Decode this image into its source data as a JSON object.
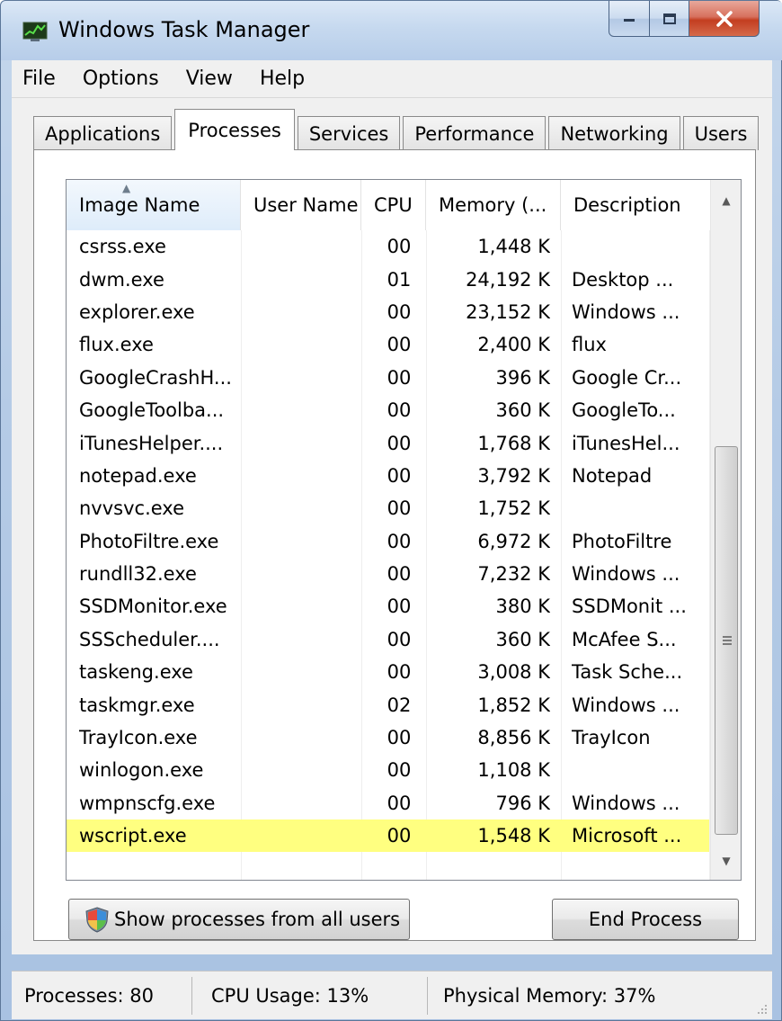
{
  "window": {
    "title": "Windows Task Manager",
    "icon": "task-manager-icon"
  },
  "menu": [
    "File",
    "Options",
    "View",
    "Help"
  ],
  "tabs": [
    {
      "label": "Applications",
      "active": false
    },
    {
      "label": "Processes",
      "active": true
    },
    {
      "label": "Services",
      "active": false
    },
    {
      "label": "Performance",
      "active": false
    },
    {
      "label": "Networking",
      "active": false
    },
    {
      "label": "Users",
      "active": false
    }
  ],
  "columns": {
    "image_name": "Image Name",
    "user_name": "User Name",
    "cpu": "CPU",
    "memory": "Memory (...",
    "description": "Description"
  },
  "processes": [
    {
      "name": "csrss.exe",
      "user": "",
      "cpu": "00",
      "memory": "1,448 K",
      "description": ""
    },
    {
      "name": "dwm.exe",
      "user": "",
      "cpu": "01",
      "memory": "24,192 K",
      "description": "Desktop ..."
    },
    {
      "name": "explorer.exe",
      "user": "",
      "cpu": "00",
      "memory": "23,152 K",
      "description": "Windows ..."
    },
    {
      "name": "flux.exe",
      "user": "",
      "cpu": "00",
      "memory": "2,400 K",
      "description": "flux"
    },
    {
      "name": "GoogleCrashH...",
      "user": "",
      "cpu": "00",
      "memory": "396 K",
      "description": "Google Cr..."
    },
    {
      "name": "GoogleToolba...",
      "user": "",
      "cpu": "00",
      "memory": "360 K",
      "description": "GoogleTo..."
    },
    {
      "name": "iTunesHelper....",
      "user": "",
      "cpu": "00",
      "memory": "1,768 K",
      "description": "iTunesHel..."
    },
    {
      "name": "notepad.exe",
      "user": "",
      "cpu": "00",
      "memory": "3,792 K",
      "description": "Notepad"
    },
    {
      "name": "nvvsvc.exe",
      "user": "",
      "cpu": "00",
      "memory": "1,752 K",
      "description": ""
    },
    {
      "name": "PhotoFiltre.exe",
      "user": "",
      "cpu": "00",
      "memory": "6,972 K",
      "description": "PhotoFiltre"
    },
    {
      "name": "rundll32.exe",
      "user": "",
      "cpu": "00",
      "memory": "7,232 K",
      "description": "Windows ..."
    },
    {
      "name": "SSDMonitor.exe",
      "user": "",
      "cpu": "00",
      "memory": "380 K",
      "description": "SSDMonit ..."
    },
    {
      "name": "SSScheduler....",
      "user": "",
      "cpu": "00",
      "memory": "360 K",
      "description": "McAfee S..."
    },
    {
      "name": "taskeng.exe",
      "user": "",
      "cpu": "00",
      "memory": "3,008 K",
      "description": "Task Sche..."
    },
    {
      "name": "taskmgr.exe",
      "user": "",
      "cpu": "02",
      "memory": "1,852 K",
      "description": "Windows ..."
    },
    {
      "name": "TrayIcon.exe",
      "user": "",
      "cpu": "00",
      "memory": "8,856 K",
      "description": "TrayIcon"
    },
    {
      "name": "winlogon.exe",
      "user": "",
      "cpu": "00",
      "memory": "1,108 K",
      "description": ""
    },
    {
      "name": "wmpnscfg.exe",
      "user": "",
      "cpu": "00",
      "memory": "796 K",
      "description": "Windows ..."
    },
    {
      "name": "wscript.exe",
      "user": "",
      "cpu": "00",
      "memory": "1,548 K",
      "description": "Microsoft ...",
      "highlighted": true
    }
  ],
  "buttons": {
    "show_all": "Show processes from all users",
    "end_process": "End Process"
  },
  "status": {
    "processes": "Processes: 80",
    "cpu_usage": "CPU Usage: 13%",
    "physical_memory": "Physical Memory: 37%"
  },
  "colors": {
    "highlight": "#ffff80",
    "close_button": "#c94a2e"
  }
}
